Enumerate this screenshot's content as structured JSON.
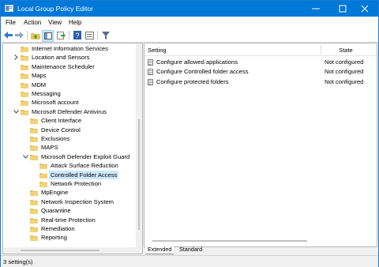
{
  "window": {
    "title": "Local Group Policy Editor"
  },
  "menu": [
    "File",
    "Action",
    "View",
    "Help"
  ],
  "tree": [
    {
      "label": "Internet Information Services",
      "indent": 1,
      "expander": ""
    },
    {
      "label": "Location and Sensors",
      "indent": 1,
      "expander": ">"
    },
    {
      "label": "Maintenance Scheduler",
      "indent": 1,
      "expander": ""
    },
    {
      "label": "Maps",
      "indent": 1,
      "expander": ""
    },
    {
      "label": "MDM",
      "indent": 1,
      "expander": ""
    },
    {
      "label": "Messaging",
      "indent": 1,
      "expander": ""
    },
    {
      "label": "Microsoft account",
      "indent": 1,
      "expander": ""
    },
    {
      "label": "Microsoft Defender Antivirus",
      "indent": 1,
      "expander": "v"
    },
    {
      "label": "Client Interface",
      "indent": 2,
      "expander": ""
    },
    {
      "label": "Device Control",
      "indent": 2,
      "expander": ""
    },
    {
      "label": "Exclusions",
      "indent": 2,
      "expander": ""
    },
    {
      "label": "MAPS",
      "indent": 2,
      "expander": ""
    },
    {
      "label": "Microsoft Defender Exploit Guard",
      "indent": 2,
      "expander": "v"
    },
    {
      "label": "Attack Surface Reduction",
      "indent": 3,
      "expander": ""
    },
    {
      "label": "Controlled Folder Access",
      "indent": 3,
      "expander": "",
      "selected": true
    },
    {
      "label": "Network Protection",
      "indent": 3,
      "expander": ""
    },
    {
      "label": "MpEngine",
      "indent": 2,
      "expander": ""
    },
    {
      "label": "Network Inspection System",
      "indent": 2,
      "expander": ""
    },
    {
      "label": "Quarantine",
      "indent": 2,
      "expander": ""
    },
    {
      "label": "Real-time Protection",
      "indent": 2,
      "expander": ""
    },
    {
      "label": "Remediation",
      "indent": 2,
      "expander": ""
    },
    {
      "label": "Reporting",
      "indent": 2,
      "expander": ""
    }
  ],
  "list": {
    "col_setting": "Setting",
    "col_state": "State",
    "rows": [
      {
        "name": "Configure allowed applications",
        "state": "Not configured"
      },
      {
        "name": "Configure Controlled folder access",
        "state": "Not configured"
      },
      {
        "name": "Configure protected folders",
        "state": "Not configured"
      }
    ]
  },
  "tabs": {
    "extended": "Extended",
    "standard": "Standard"
  },
  "status": {
    "text": "3 setting(s)"
  },
  "colors": {
    "titlebar": "#0078d7",
    "selection": "#cce8ff",
    "folder": "#e8c25a"
  }
}
